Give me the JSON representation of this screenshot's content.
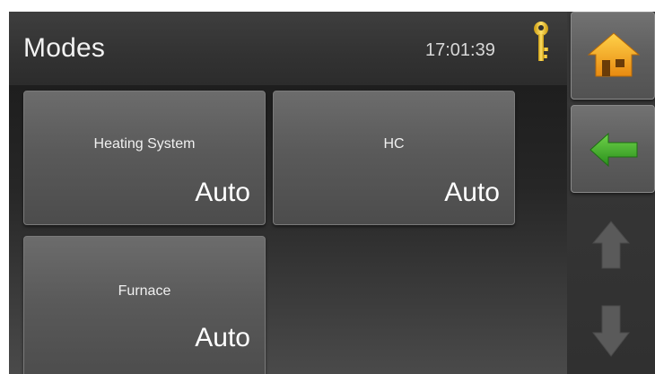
{
  "header": {
    "title": "Modes",
    "clock": "17:01:39",
    "key_icon": "key-icon"
  },
  "tiles": [
    {
      "label": "Heating System",
      "value": "Auto"
    },
    {
      "label": "HC",
      "value": "Auto"
    },
    {
      "label": "Furnace",
      "value": "Auto"
    }
  ],
  "sidebar": {
    "home_icon": "home-icon",
    "back_icon": "back-arrow-icon",
    "up_icon": "scroll-up-arrow-icon",
    "down_icon": "scroll-down-arrow-icon"
  },
  "colors": {
    "accent_home": "#f2a51a",
    "accent_back": "#3fae2a",
    "key": "#f0c020",
    "disabled_arrow": "#5a5a5a"
  }
}
